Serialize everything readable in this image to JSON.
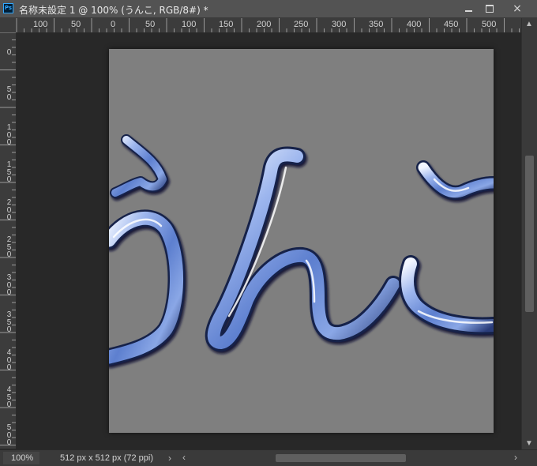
{
  "app": {
    "logo_text": "Ps"
  },
  "window": {
    "title": "名称未設定 1 @ 100% (うんこ, RGB/8#) *"
  },
  "window_controls": {
    "minimize": "minimize-icon",
    "maximize": "maximize-icon",
    "close": "×"
  },
  "rulers": {
    "horizontal_ticks": [
      "100",
      "50",
      "0",
      "50",
      "100",
      "150",
      "200",
      "250",
      "300",
      "350",
      "400",
      "450",
      "500"
    ],
    "vertical_ticks": [
      "0",
      "50",
      "100",
      "150",
      "200",
      "250",
      "300",
      "350",
      "400",
      "450",
      "500"
    ]
  },
  "canvas": {
    "layer_text": "うんこ",
    "document_color": "#7f7f7f",
    "pasteboard_color": "#282828",
    "text_colors": {
      "highlight": "#e8f0ff",
      "base": "#6f8fd8",
      "shadow": "#0d1433"
    }
  },
  "status_bar": {
    "zoom": "100%",
    "doc_info": "512 px x 512 px (72 ppi)",
    "arrow": "›"
  },
  "scrollbars": {
    "up": "▲",
    "down": "▼",
    "left": "‹",
    "right": "›"
  }
}
